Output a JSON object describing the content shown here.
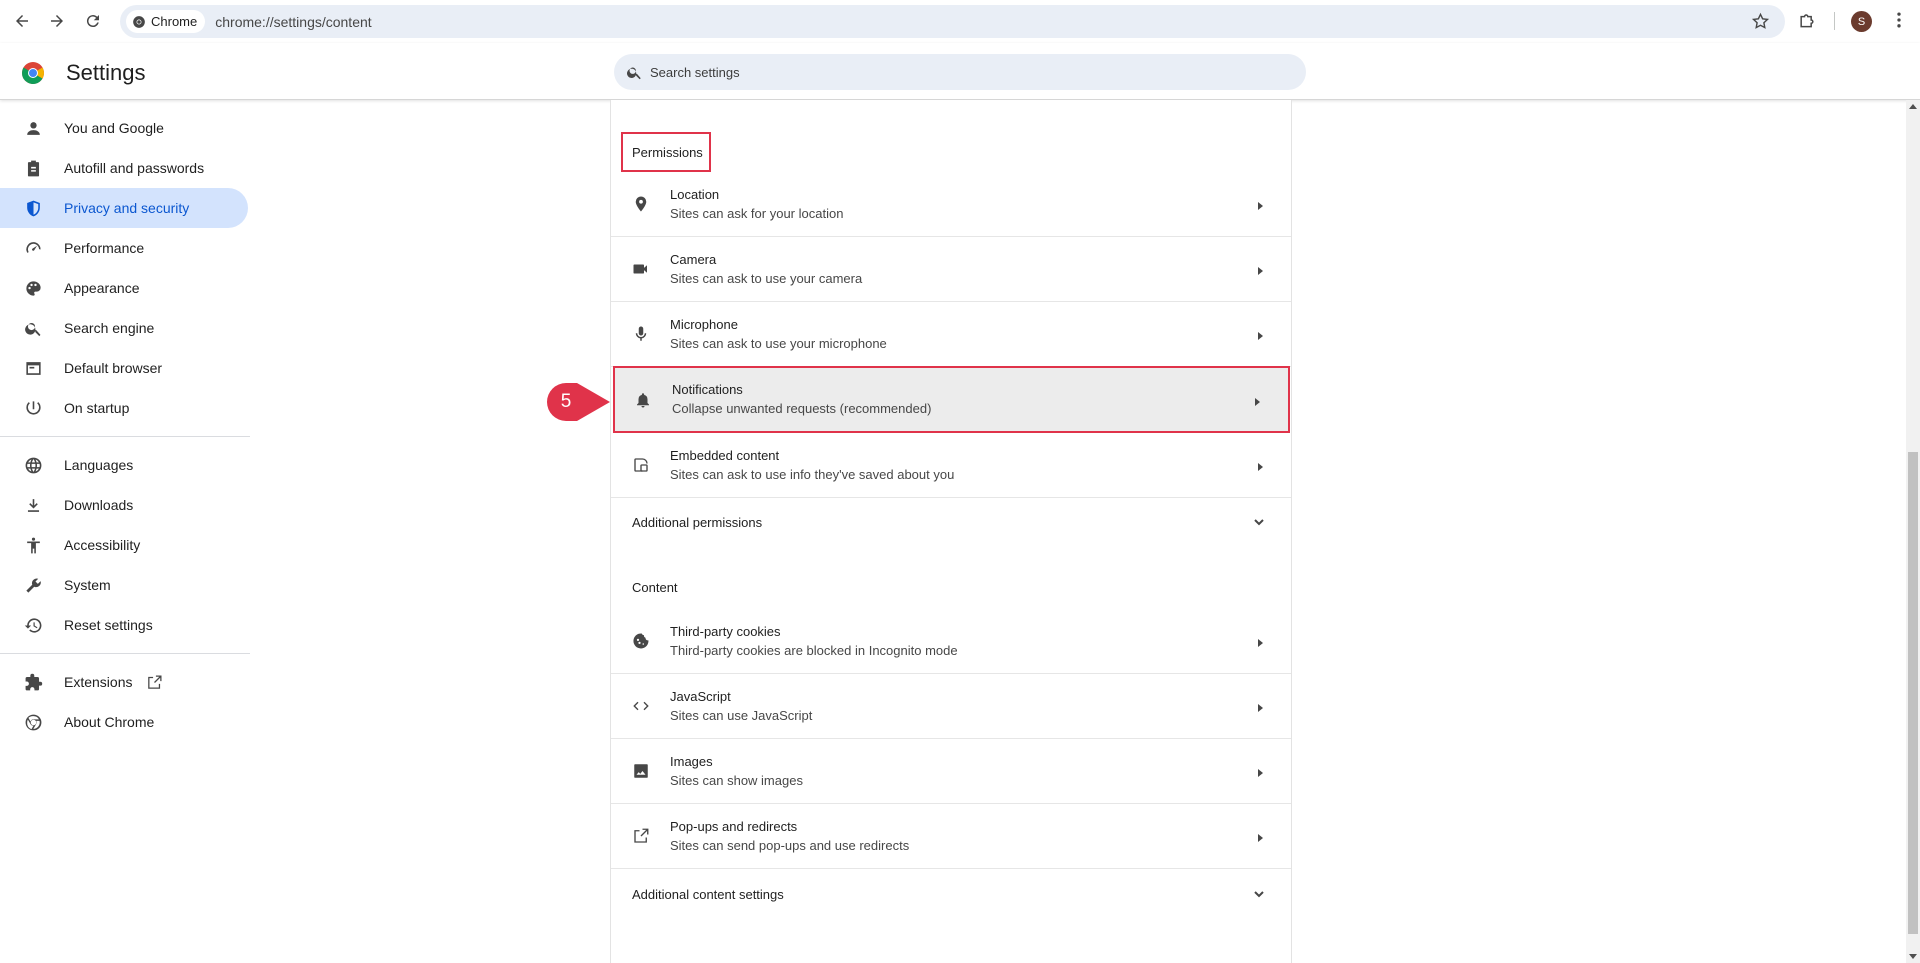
{
  "browser": {
    "chip_label": "Chrome",
    "url": "chrome://settings/content",
    "profile_initial": "S"
  },
  "header": {
    "title": "Settings",
    "search_placeholder": "Search settings"
  },
  "sidebar": {
    "items": [
      {
        "label": "You and Google",
        "icon": "person-icon"
      },
      {
        "label": "Autofill and passwords",
        "icon": "clipboard-icon"
      },
      {
        "label": "Privacy and security",
        "icon": "shield-icon",
        "active": true
      },
      {
        "label": "Performance",
        "icon": "speedometer-icon"
      },
      {
        "label": "Appearance",
        "icon": "palette-icon"
      },
      {
        "label": "Search engine",
        "icon": "search-icon"
      },
      {
        "label": "Default browser",
        "icon": "browser-window-icon"
      },
      {
        "label": "On startup",
        "icon": "power-icon"
      },
      {
        "label": "Languages",
        "icon": "globe-icon"
      },
      {
        "label": "Downloads",
        "icon": "download-icon"
      },
      {
        "label": "Accessibility",
        "icon": "accessibility-icon"
      },
      {
        "label": "System",
        "icon": "wrench-icon"
      },
      {
        "label": "Reset settings",
        "icon": "history-icon"
      },
      {
        "label": "Extensions",
        "icon": "puzzle-icon"
      },
      {
        "label": "About Chrome",
        "icon": "chrome-icon"
      }
    ]
  },
  "permissions": {
    "heading": "Permissions",
    "rows": [
      {
        "title": "Location",
        "sub": "Sites can ask for your location",
        "icon": "location-pin-icon"
      },
      {
        "title": "Camera",
        "sub": "Sites can ask to use your camera",
        "icon": "camera-icon"
      },
      {
        "title": "Microphone",
        "sub": "Sites can ask to use your microphone",
        "icon": "microphone-icon"
      },
      {
        "title": "Notifications",
        "sub": "Collapse unwanted requests (recommended)",
        "icon": "bell-icon"
      },
      {
        "title": "Embedded content",
        "sub": "Sites can ask to use info they've saved about you",
        "icon": "embedded-content-icon"
      }
    ],
    "additional": "Additional permissions"
  },
  "content": {
    "heading": "Content",
    "rows": [
      {
        "title": "Third-party cookies",
        "sub": "Third-party cookies are blocked in Incognito mode",
        "icon": "cookie-icon"
      },
      {
        "title": "JavaScript",
        "sub": "Sites can use JavaScript",
        "icon": "code-icon"
      },
      {
        "title": "Images",
        "sub": "Sites can show images",
        "icon": "image-icon"
      },
      {
        "title": "Pop-ups and redirects",
        "sub": "Sites can send pop-ups and use redirects",
        "icon": "open-external-icon"
      }
    ],
    "additional": "Additional content settings"
  },
  "annotation": {
    "step_number": "5",
    "color": "#e0334a"
  },
  "colors": {
    "accent": "#0b57d0",
    "active_bg": "#d3e3fd",
    "highlight": "#e0334a"
  }
}
